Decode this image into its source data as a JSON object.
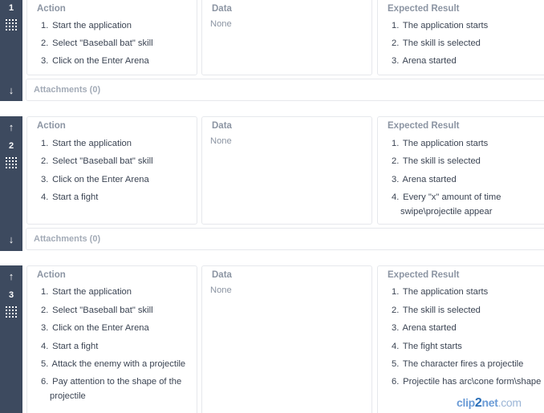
{
  "columns": {
    "action": "Action",
    "data": "Data",
    "expected": "Expected Result"
  },
  "attachments_label": "Attachments (0)",
  "steps": [
    {
      "number": "1",
      "data": "None",
      "actions": [
        {
          "n": "1.",
          "text": "Start the application"
        },
        {
          "n": "2.",
          "text": "Select \"Baseball bat\" skill"
        },
        {
          "n": "3.",
          "text": "Click on the Enter Arena"
        }
      ],
      "expected": [
        {
          "n": "1.",
          "text": "The application starts"
        },
        {
          "n": "2.",
          "text": "The skill is selected"
        },
        {
          "n": "3.",
          "text": "Arena started"
        }
      ]
    },
    {
      "number": "2",
      "data": "None",
      "actions": [
        {
          "n": "1.",
          "text": "Start the application"
        },
        {
          "n": "2.",
          "text": "Select \"Baseball bat\" skill"
        },
        {
          "n": "3.",
          "text": "Click on the Enter Arena"
        },
        {
          "n": "4.",
          "text": "Start a fight"
        }
      ],
      "expected": [
        {
          "n": "1.",
          "text": "The application starts"
        },
        {
          "n": "2.",
          "text": "The skill is selected"
        },
        {
          "n": "3.",
          "text": "Arena started"
        },
        {
          "n": "4.",
          "text": "Every \"x\" amount of time",
          "cont": "swipe\\projectile appear"
        }
      ]
    },
    {
      "number": "3",
      "data": "None",
      "actions": [
        {
          "n": "1.",
          "text": "Start the application"
        },
        {
          "n": "2.",
          "text": "Select \"Baseball bat\" skill"
        },
        {
          "n": "3.",
          "text": "Click on the Enter Arena"
        },
        {
          "n": "4.",
          "text": "Start a fight"
        },
        {
          "n": "5.",
          "text": "Attack the enemy with a projectile"
        },
        {
          "n": "6.",
          "text": "Pay attention to the shape of the",
          "cont": "projectile"
        }
      ],
      "expected": [
        {
          "n": "1.",
          "text": "The application starts"
        },
        {
          "n": "2.",
          "text": "The skill is selected"
        },
        {
          "n": "3.",
          "text": "Arena started"
        },
        {
          "n": "4.",
          "text": "The fight starts"
        },
        {
          "n": "5.",
          "text": "The character fires a projectile"
        },
        {
          "n": "6.",
          "text": "Projectile has arc\\cone form\\shape"
        }
      ]
    }
  ],
  "icons": {
    "move_up": "arrow-up-icon",
    "move_down": "arrow-down-icon",
    "drag": "drag-grip-icon"
  },
  "colors": {
    "rail": "#3d4a5f",
    "muted_text": "#8c95a3",
    "border": "#e6e8ec"
  },
  "watermark": {
    "part1": "clip",
    "part2": "2",
    "part3": "net",
    "part4": ".com"
  }
}
